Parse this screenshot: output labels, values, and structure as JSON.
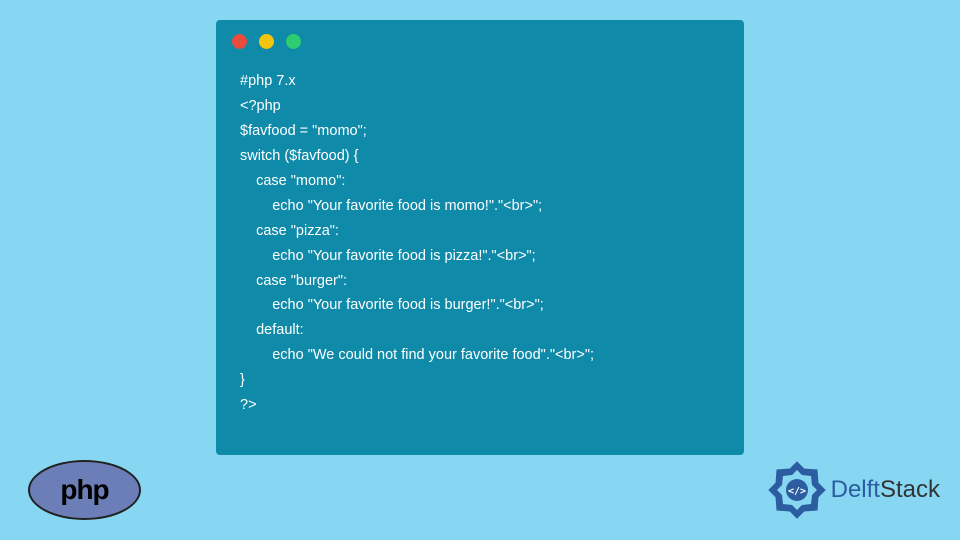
{
  "code": {
    "lines": [
      "#php 7.x",
      "<?php",
      "$favfood = \"momo\";",
      "switch ($favfood) {",
      "    case \"momo\":",
      "        echo \"Your favorite food is momo!\".\"<br>\";",
      "    case \"pizza\":",
      "        echo \"Your favorite food is pizza!\".\"<br>\";",
      "    case \"burger\":",
      "        echo \"Your favorite food is burger!\".\"<br>\";",
      "    default:",
      "        echo \"We could not find your favorite food\".\"<br>\";",
      "}",
      "?>"
    ]
  },
  "phpLogo": {
    "text": "php"
  },
  "delftStack": {
    "delft": "Delft",
    "stack": "Stack"
  }
}
